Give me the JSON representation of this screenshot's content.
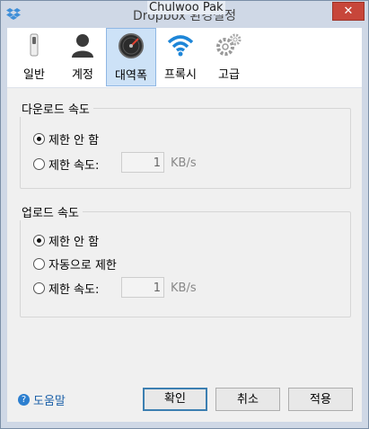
{
  "window": {
    "title": "Dropbox 환경설정",
    "title_overlay": "Chulwoo Pak",
    "close_label": "✕"
  },
  "tabs": [
    {
      "label": "일반",
      "icon": "switch-icon"
    },
    {
      "label": "계정",
      "icon": "user-icon"
    },
    {
      "label": "대역폭",
      "icon": "gauge-icon",
      "active": true
    },
    {
      "label": "프록시",
      "icon": "wifi-icon"
    },
    {
      "label": "고급",
      "icon": "gears-icon"
    }
  ],
  "download": {
    "title": "다운로드 속도",
    "options": [
      {
        "label": "제한 안 함",
        "checked": true
      },
      {
        "label": "제한 속도:",
        "checked": false
      }
    ],
    "speed_value": "1",
    "unit": "KB/s"
  },
  "upload": {
    "title": "업로드 속도",
    "options": [
      {
        "label": "제한 안 함",
        "checked": true
      },
      {
        "label": "자동으로 제한",
        "checked": false
      },
      {
        "label": "제한 속도:",
        "checked": false
      }
    ],
    "speed_value": "1",
    "unit": "KB/s"
  },
  "footer": {
    "help_label": "도움말",
    "ok_label": "확인",
    "cancel_label": "취소",
    "apply_label": "적용"
  },
  "colors": {
    "accent": "#3c7fb1",
    "close": "#c7463a",
    "active_tab": "#cde2f7"
  }
}
